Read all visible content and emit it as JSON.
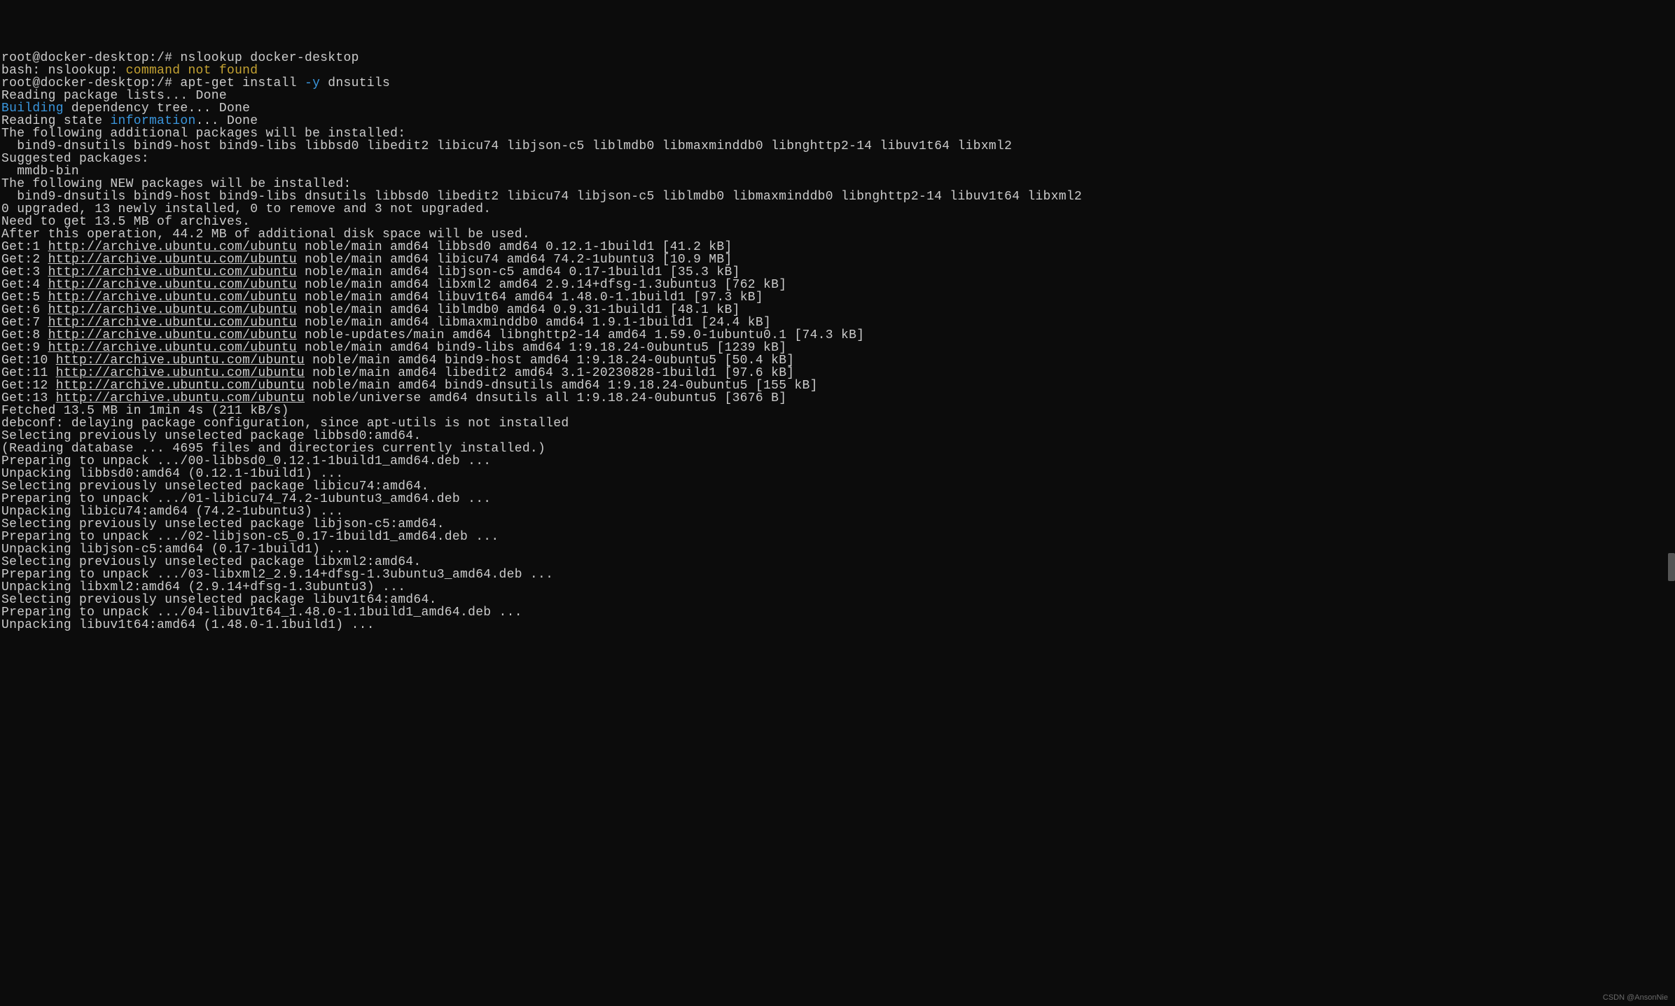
{
  "lines": [
    {
      "segments": [
        {
          "t": "root@docker-desktop:/# nslookup docker-desktop"
        }
      ]
    },
    {
      "segments": [
        {
          "t": "bash: nslookup: "
        },
        {
          "t": "command not found",
          "c": "yellow"
        }
      ]
    },
    {
      "segments": [
        {
          "t": "root@docker-desktop:/# apt-get install "
        },
        {
          "t": "-y",
          "c": "cyan"
        },
        {
          "t": " dnsutils"
        }
      ]
    },
    {
      "segments": [
        {
          "t": "Reading package lists... Done"
        }
      ]
    },
    {
      "segments": [
        {
          "t": "Building",
          "c": "cyan"
        },
        {
          "t": " dependency tree... Done"
        }
      ]
    },
    {
      "segments": [
        {
          "t": "Reading state "
        },
        {
          "t": "information",
          "c": "cyan"
        },
        {
          "t": "... Done"
        }
      ]
    },
    {
      "segments": [
        {
          "t": "The following additional packages will be installed:"
        }
      ]
    },
    {
      "segments": [
        {
          "t": "  bind9-dnsutils bind9-host bind9-libs libbsd0 libedit2 libicu74 libjson-c5 liblmdb0 libmaxminddb0 libnghttp2-14 libuv1t64 libxml2"
        }
      ]
    },
    {
      "segments": [
        {
          "t": "Suggested packages:"
        }
      ]
    },
    {
      "segments": [
        {
          "t": "  mmdb-bin"
        }
      ]
    },
    {
      "segments": [
        {
          "t": "The following NEW packages will be installed:"
        }
      ]
    },
    {
      "segments": [
        {
          "t": "  bind9-dnsutils bind9-host bind9-libs dnsutils libbsd0 libedit2 libicu74 libjson-c5 liblmdb0 libmaxminddb0 libnghttp2-14 libuv1t64 libxml2"
        }
      ]
    },
    {
      "segments": [
        {
          "t": "0 upgraded, 13 newly installed, 0 to remove and 3 not upgraded."
        }
      ]
    },
    {
      "segments": [
        {
          "t": "Need to get 13.5 MB of archives."
        }
      ]
    },
    {
      "segments": [
        {
          "t": "After this operation, 44.2 MB of additional disk space will be used."
        }
      ]
    },
    {
      "segments": [
        {
          "t": "Get:1 "
        },
        {
          "t": "http://archive.ubuntu.com/ubuntu",
          "c": "url"
        },
        {
          "t": " noble/main amd64 libbsd0 amd64 0.12.1-1build1 [41.2 kB]"
        }
      ]
    },
    {
      "segments": [
        {
          "t": "Get:2 "
        },
        {
          "t": "http://archive.ubuntu.com/ubuntu",
          "c": "url"
        },
        {
          "t": " noble/main amd64 libicu74 amd64 74.2-1ubuntu3 [10.9 MB]"
        }
      ]
    },
    {
      "segments": [
        {
          "t": "Get:3 "
        },
        {
          "t": "http://archive.ubuntu.com/ubuntu",
          "c": "url"
        },
        {
          "t": " noble/main amd64 libjson-c5 amd64 0.17-1build1 [35.3 kB]"
        }
      ]
    },
    {
      "segments": [
        {
          "t": "Get:4 "
        },
        {
          "t": "http://archive.ubuntu.com/ubuntu",
          "c": "url"
        },
        {
          "t": " noble/main amd64 libxml2 amd64 2.9.14+dfsg-1.3ubuntu3 [762 kB]"
        }
      ]
    },
    {
      "segments": [
        {
          "t": "Get:5 "
        },
        {
          "t": "http://archive.ubuntu.com/ubuntu",
          "c": "url"
        },
        {
          "t": " noble/main amd64 libuv1t64 amd64 1.48.0-1.1build1 [97.3 kB]"
        }
      ]
    },
    {
      "segments": [
        {
          "t": "Get:6 "
        },
        {
          "t": "http://archive.ubuntu.com/ubuntu",
          "c": "url"
        },
        {
          "t": " noble/main amd64 liblmdb0 amd64 0.9.31-1build1 [48.1 kB]"
        }
      ]
    },
    {
      "segments": [
        {
          "t": "Get:7 "
        },
        {
          "t": "http://archive.ubuntu.com/ubuntu",
          "c": "url"
        },
        {
          "t": " noble/main amd64 libmaxminddb0 amd64 1.9.1-1build1 [24.4 kB]"
        }
      ]
    },
    {
      "segments": [
        {
          "t": "Get:8 "
        },
        {
          "t": "http://archive.ubuntu.com/ubuntu",
          "c": "url"
        },
        {
          "t": " noble-updates/main amd64 libnghttp2-14 amd64 1.59.0-1ubuntu0.1 [74.3 kB]"
        }
      ]
    },
    {
      "segments": [
        {
          "t": "Get:9 "
        },
        {
          "t": "http://archive.ubuntu.com/ubuntu",
          "c": "url"
        },
        {
          "t": " noble/main amd64 bind9-libs amd64 1:9.18.24-0ubuntu5 [1239 kB]"
        }
      ]
    },
    {
      "segments": [
        {
          "t": "Get:10 "
        },
        {
          "t": "http://archive.ubuntu.com/ubuntu",
          "c": "url"
        },
        {
          "t": " noble/main amd64 bind9-host amd64 1:9.18.24-0ubuntu5 [50.4 kB]"
        }
      ]
    },
    {
      "segments": [
        {
          "t": "Get:11 "
        },
        {
          "t": "http://archive.ubuntu.com/ubuntu",
          "c": "url"
        },
        {
          "t": " noble/main amd64 libedit2 amd64 3.1-20230828-1build1 [97.6 kB]"
        }
      ]
    },
    {
      "segments": [
        {
          "t": "Get:12 "
        },
        {
          "t": "http://archive.ubuntu.com/ubuntu",
          "c": "url"
        },
        {
          "t": " noble/main amd64 bind9-dnsutils amd64 1:9.18.24-0ubuntu5 [155 kB]"
        }
      ]
    },
    {
      "segments": [
        {
          "t": "Get:13 "
        },
        {
          "t": "http://archive.ubuntu.com/ubuntu",
          "c": "url"
        },
        {
          "t": " noble/universe amd64 dnsutils all 1:9.18.24-0ubuntu5 [3676 B]"
        }
      ]
    },
    {
      "segments": [
        {
          "t": "Fetched 13.5 MB in 1min 4s (211 kB/s)"
        }
      ]
    },
    {
      "segments": [
        {
          "t": "debconf: delaying package configuration, since apt-utils is not installed"
        }
      ]
    },
    {
      "segments": [
        {
          "t": "Selecting previously unselected package libbsd0:amd64."
        }
      ]
    },
    {
      "segments": [
        {
          "t": "(Reading database ... 4695 files and directories currently installed.)"
        }
      ]
    },
    {
      "segments": [
        {
          "t": "Preparing to unpack .../00-libbsd0_0.12.1-1build1_amd64.deb ..."
        }
      ]
    },
    {
      "segments": [
        {
          "t": "Unpacking libbsd0:amd64 (0.12.1-1build1) ..."
        }
      ]
    },
    {
      "segments": [
        {
          "t": "Selecting previously unselected package libicu74:amd64."
        }
      ]
    },
    {
      "segments": [
        {
          "t": "Preparing to unpack .../01-libicu74_74.2-1ubuntu3_amd64.deb ..."
        }
      ]
    },
    {
      "segments": [
        {
          "t": "Unpacking libicu74:amd64 (74.2-1ubuntu3) ..."
        }
      ]
    },
    {
      "segments": [
        {
          "t": "Selecting previously unselected package libjson-c5:amd64."
        }
      ]
    },
    {
      "segments": [
        {
          "t": "Preparing to unpack .../02-libjson-c5_0.17-1build1_amd64.deb ..."
        }
      ]
    },
    {
      "segments": [
        {
          "t": "Unpacking libjson-c5:amd64 (0.17-1build1) ..."
        }
      ]
    },
    {
      "segments": [
        {
          "t": "Selecting previously unselected package libxml2:amd64."
        }
      ]
    },
    {
      "segments": [
        {
          "t": "Preparing to unpack .../03-libxml2_2.9.14+dfsg-1.3ubuntu3_amd64.deb ..."
        }
      ]
    },
    {
      "segments": [
        {
          "t": "Unpacking libxml2:amd64 (2.9.14+dfsg-1.3ubuntu3) ..."
        }
      ]
    },
    {
      "segments": [
        {
          "t": "Selecting previously unselected package libuv1t64:amd64."
        }
      ]
    },
    {
      "segments": [
        {
          "t": "Preparing to unpack .../04-libuv1t64_1.48.0-1.1build1_amd64.deb ..."
        }
      ]
    },
    {
      "segments": [
        {
          "t": "Unpacking libuv1t64:amd64 (1.48.0-1.1build1) ..."
        }
      ]
    }
  ],
  "watermark": "CSDN @AnsonNie"
}
